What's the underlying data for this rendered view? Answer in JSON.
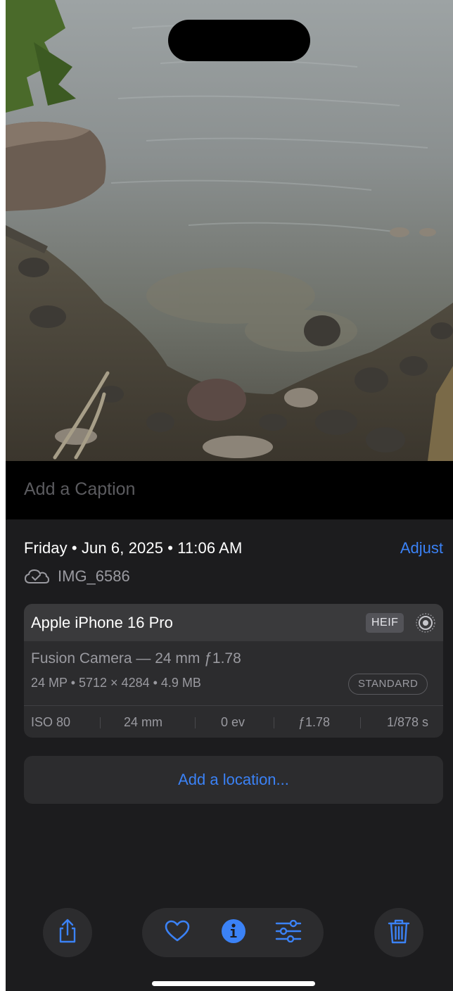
{
  "caption": {
    "placeholder": "Add a Caption"
  },
  "info": {
    "date_line": "Friday • Jun 6, 2025 • 11:06 AM",
    "adjust_label": "Adjust",
    "file_name": "IMG_6586"
  },
  "camera": {
    "device": "Apple iPhone 16 Pro",
    "format_badge": "HEIF",
    "lens": "Fusion Camera — 24 mm ƒ1.78",
    "specs": "24 MP • 5712 × 4284 • 4.9 MB",
    "style_badge": "STANDARD",
    "exif": {
      "iso": "ISO 80",
      "focal": "24 mm",
      "exposure": "0 ev",
      "aperture": "ƒ1.78",
      "shutter": "1/878 s"
    }
  },
  "location": {
    "label": "Add a location..."
  },
  "toolbar": {
    "share_icon": "share-icon",
    "favorite_icon": "heart-icon",
    "info_icon": "info-icon",
    "edit_icon": "sliders-icon",
    "delete_icon": "trash-icon"
  },
  "colors": {
    "accent": "#3b82f6",
    "sheet": "#1c1c1e",
    "card": "#2c2c2e",
    "secondary_text": "#9a9aa0"
  }
}
